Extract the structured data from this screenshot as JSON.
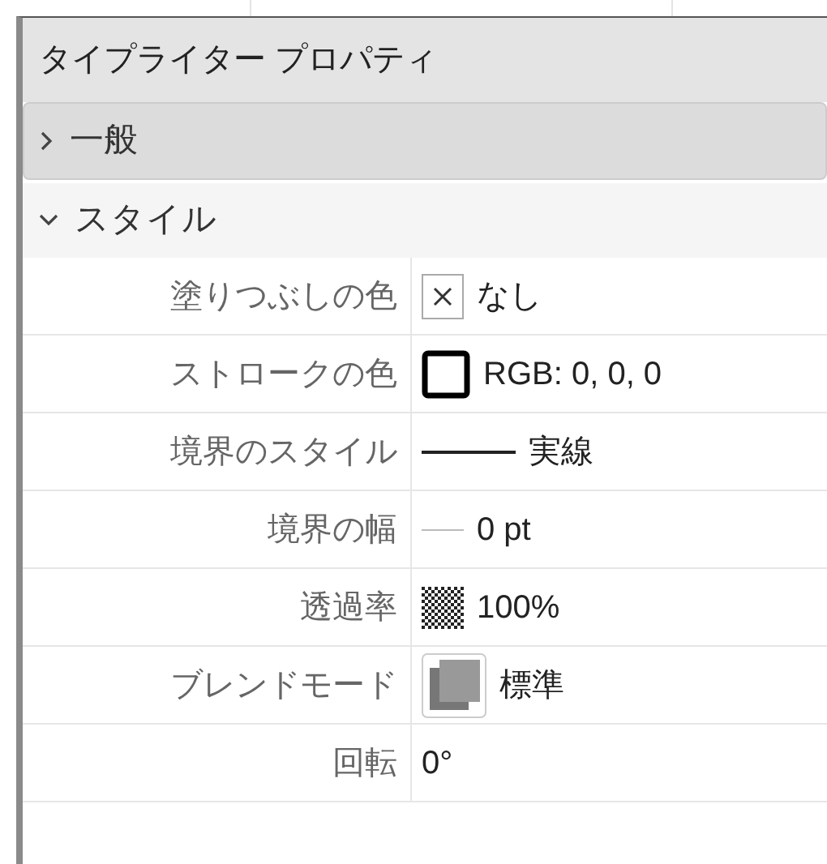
{
  "panel": {
    "title": "タイプライター プロパティ"
  },
  "sections": [
    {
      "label": "一般",
      "expanded": false
    },
    {
      "label": "スタイル",
      "expanded": true,
      "rows": [
        {
          "label": "塗りつぶしの色",
          "kind": "none-swatch",
          "value": "なし"
        },
        {
          "label": "ストロークの色",
          "kind": "color-swatch",
          "color": "#000000",
          "value": "RGB: 0, 0, 0"
        },
        {
          "label": "境界のスタイル",
          "kind": "line-style",
          "value": "実線"
        },
        {
          "label": "境界の幅",
          "kind": "line-width",
          "value": "0 pt"
        },
        {
          "label": "透過率",
          "kind": "transparency",
          "value": "100%"
        },
        {
          "label": "ブレンドモード",
          "kind": "blend",
          "value": "標準"
        },
        {
          "label": "回転",
          "kind": "text",
          "value": "0°"
        }
      ]
    }
  ]
}
